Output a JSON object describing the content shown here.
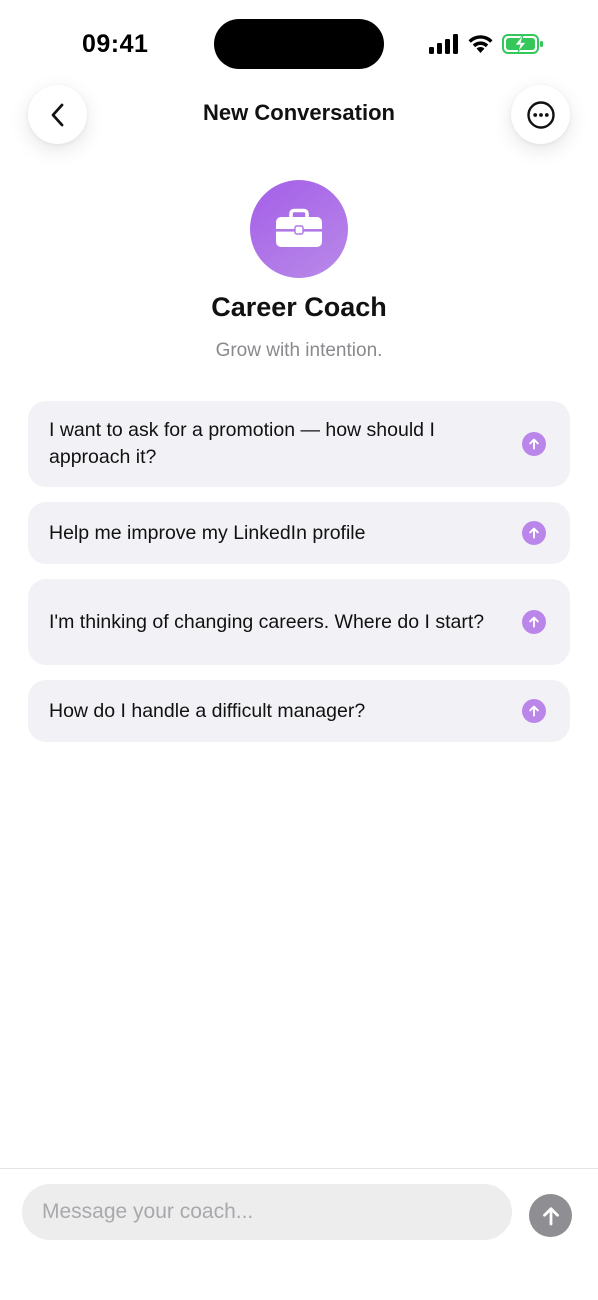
{
  "status_bar": {
    "time": "09:41",
    "battery_color": "#34c759"
  },
  "header": {
    "title": "New Conversation",
    "back_icon": "chevron-left-icon",
    "more_icon": "ellipsis-circle-icon"
  },
  "coach": {
    "avatar_icon": "briefcase-icon",
    "name": "Career Coach",
    "tagline": "Grow with intention.",
    "accent_color": "#a45ee8"
  },
  "suggestions": [
    {
      "text": "I want to ask for a promotion — how should I approach it?"
    },
    {
      "text": "Help me improve my LinkedIn profile"
    },
    {
      "text": "I'm thinking of changing careers. Where do I start?"
    },
    {
      "text": "How do I handle a difficult manager?"
    }
  ],
  "composer": {
    "placeholder": "Message your coach...",
    "value": "",
    "send_icon": "arrow-up-icon"
  }
}
